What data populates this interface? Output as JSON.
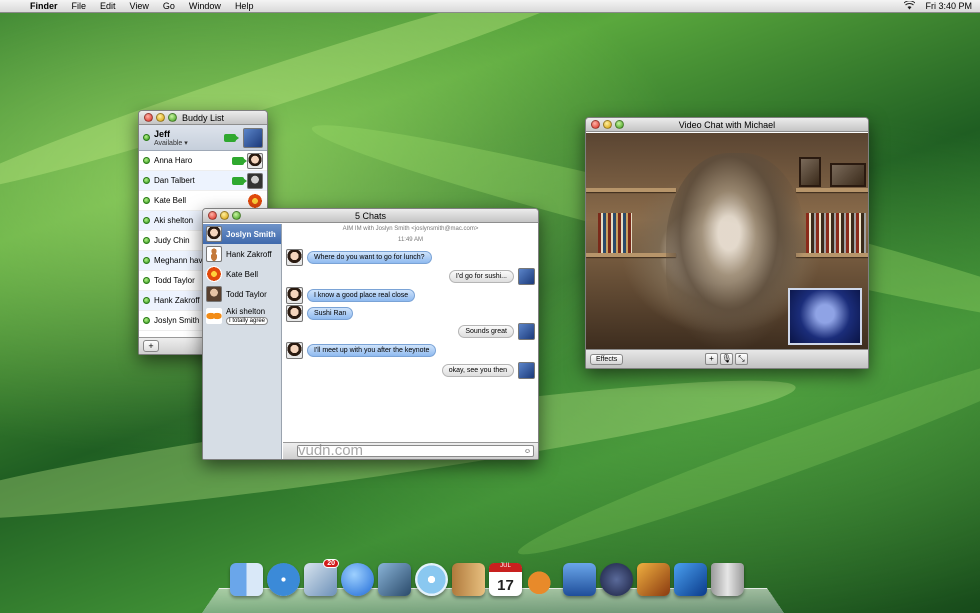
{
  "menubar": {
    "apple_icon": "apple-icon",
    "items": [
      "Finder",
      "File",
      "Edit",
      "View",
      "Go",
      "Window",
      "Help"
    ],
    "clock": "Fri 3:40 PM",
    "wifi_icon": "wifi-icon"
  },
  "buddy_list": {
    "title": "Buddy List",
    "me": {
      "name": "Jeff",
      "status": "Available ▾"
    },
    "buddies": [
      {
        "name": "Anna Haro"
      },
      {
        "name": "Dan Talbert"
      },
      {
        "name": "Kate Bell"
      },
      {
        "name": "Aki shelton"
      },
      {
        "name": "Judy Chin"
      },
      {
        "name": "Meghann haver"
      },
      {
        "name": "Todd Taylor"
      },
      {
        "name": "Hank Zakroff"
      },
      {
        "name": "Joslyn Smith"
      }
    ],
    "add_label": "+",
    "font_label": "A"
  },
  "chat": {
    "title": "5 Chats",
    "header": "AIM IM with Joslyn Smith <joslynsmith@mac.com>",
    "time": "11:49 AM",
    "tabs": [
      {
        "name": "Joslyn Smith"
      },
      {
        "name": "Hank Zakroff"
      },
      {
        "name": "Kate Bell"
      },
      {
        "name": "Todd Taylor"
      },
      {
        "name": "Aki shelton",
        "sub": "I totally agree"
      }
    ],
    "messages": [
      {
        "side": "left",
        "text": "Where do you want to go for lunch?"
      },
      {
        "side": "right",
        "text": "I'd go for sushi..."
      },
      {
        "side": "left",
        "text": "I know a good place real close"
      },
      {
        "side": "left",
        "text": "Sushi Ran"
      },
      {
        "side": "right",
        "text": "Sounds great"
      },
      {
        "side": "left",
        "text": "I'll meet up with you after the keynote"
      },
      {
        "side": "right",
        "text": "okay, see you then"
      }
    ],
    "watermark": "vudn.com"
  },
  "video": {
    "title": "Video Chat with Michael",
    "effects_label": "Effects"
  },
  "dock": {
    "mail_badge": "20",
    "calendar_month": "JUL",
    "calendar_day": "17",
    "icons": [
      "finder-icon",
      "safari-icon",
      "mail-icon",
      "ichat-icon",
      "iphoto-icon",
      "itunes-icon",
      "address-book-icon",
      "ical-icon",
      "garageband-icon",
      "preview-icon",
      "time-machine-icon",
      "system-prefs-icon",
      "imovie-icon",
      "trash-icon"
    ]
  }
}
